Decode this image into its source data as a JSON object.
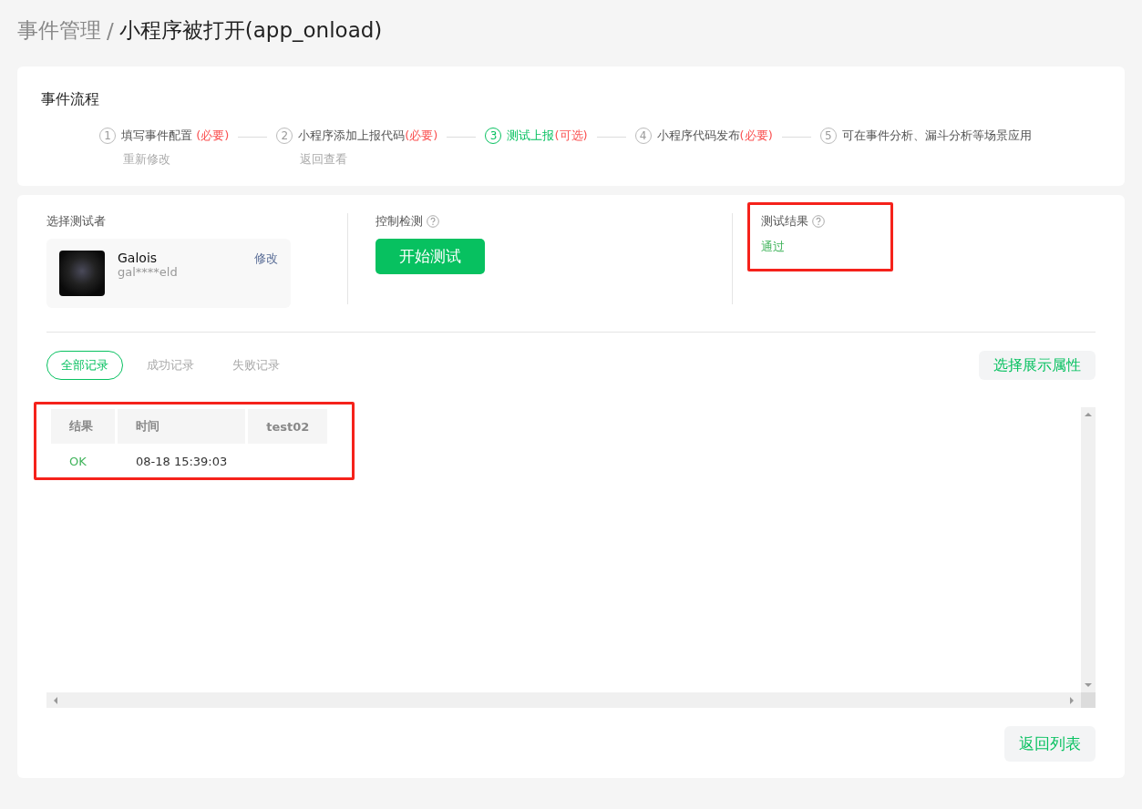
{
  "breadcrumb": {
    "parent": "事件管理",
    "separator": "/",
    "current": "小程序被打开(app_onload)"
  },
  "flow": {
    "title": "事件流程",
    "steps": [
      {
        "number": "1",
        "label": "填写事件配置 ",
        "tag": "(必要)",
        "link": "重新修改",
        "current": false
      },
      {
        "number": "2",
        "label": "小程序添加上报代码",
        "tag": "(必要)",
        "link": "返回查看",
        "current": false
      },
      {
        "number": "3",
        "label": "测试上报",
        "tag": "(可选)",
        "current": true
      },
      {
        "number": "4",
        "label": "小程序代码发布",
        "tag": "(必要)",
        "current": false
      },
      {
        "number": "5",
        "label": "可在事件分析、漏斗分析等场景应用",
        "current": false
      }
    ]
  },
  "tester": {
    "label": "选择测试者",
    "name": "Galois",
    "account": "gal****eld",
    "edit": "修改"
  },
  "control": {
    "label": "控制检测",
    "button": "开始测试"
  },
  "result": {
    "label": "测试结果",
    "value": "通过",
    "highlighted": true
  },
  "record_tabs": [
    {
      "label": "全部记录",
      "selected": true
    },
    {
      "label": "成功记录",
      "selected": false
    },
    {
      "label": "失败记录",
      "selected": false
    }
  ],
  "attributes_button": "选择展示属性",
  "table": {
    "highlighted": true,
    "columns": [
      "结果",
      "时间",
      "test02"
    ],
    "rows": [
      {
        "result": "OK",
        "passed": true,
        "time": "08-18 15:39:03"
      }
    ]
  },
  "back_button": "返回列表"
}
